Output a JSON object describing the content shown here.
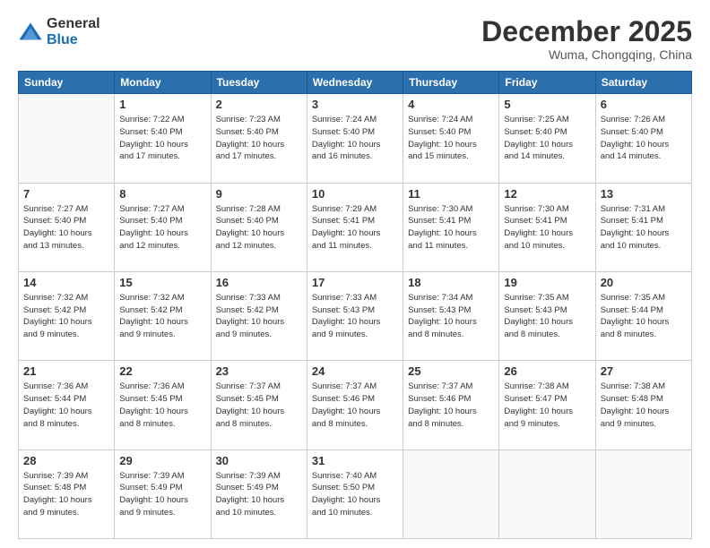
{
  "logo": {
    "general": "General",
    "blue": "Blue"
  },
  "header": {
    "month": "December 2025",
    "location": "Wuma, Chongqing, China"
  },
  "weekdays": [
    "Sunday",
    "Monday",
    "Tuesday",
    "Wednesday",
    "Thursday",
    "Friday",
    "Saturday"
  ],
  "weeks": [
    [
      {
        "day": "",
        "info": ""
      },
      {
        "day": "1",
        "info": "Sunrise: 7:22 AM\nSunset: 5:40 PM\nDaylight: 10 hours\nand 17 minutes."
      },
      {
        "day": "2",
        "info": "Sunrise: 7:23 AM\nSunset: 5:40 PM\nDaylight: 10 hours\nand 17 minutes."
      },
      {
        "day": "3",
        "info": "Sunrise: 7:24 AM\nSunset: 5:40 PM\nDaylight: 10 hours\nand 16 minutes."
      },
      {
        "day": "4",
        "info": "Sunrise: 7:24 AM\nSunset: 5:40 PM\nDaylight: 10 hours\nand 15 minutes."
      },
      {
        "day": "5",
        "info": "Sunrise: 7:25 AM\nSunset: 5:40 PM\nDaylight: 10 hours\nand 14 minutes."
      },
      {
        "day": "6",
        "info": "Sunrise: 7:26 AM\nSunset: 5:40 PM\nDaylight: 10 hours\nand 14 minutes."
      }
    ],
    [
      {
        "day": "7",
        "info": "Sunrise: 7:27 AM\nSunset: 5:40 PM\nDaylight: 10 hours\nand 13 minutes."
      },
      {
        "day": "8",
        "info": "Sunrise: 7:27 AM\nSunset: 5:40 PM\nDaylight: 10 hours\nand 12 minutes."
      },
      {
        "day": "9",
        "info": "Sunrise: 7:28 AM\nSunset: 5:40 PM\nDaylight: 10 hours\nand 12 minutes."
      },
      {
        "day": "10",
        "info": "Sunrise: 7:29 AM\nSunset: 5:41 PM\nDaylight: 10 hours\nand 11 minutes."
      },
      {
        "day": "11",
        "info": "Sunrise: 7:30 AM\nSunset: 5:41 PM\nDaylight: 10 hours\nand 11 minutes."
      },
      {
        "day": "12",
        "info": "Sunrise: 7:30 AM\nSunset: 5:41 PM\nDaylight: 10 hours\nand 10 minutes."
      },
      {
        "day": "13",
        "info": "Sunrise: 7:31 AM\nSunset: 5:41 PM\nDaylight: 10 hours\nand 10 minutes."
      }
    ],
    [
      {
        "day": "14",
        "info": "Sunrise: 7:32 AM\nSunset: 5:42 PM\nDaylight: 10 hours\nand 9 minutes."
      },
      {
        "day": "15",
        "info": "Sunrise: 7:32 AM\nSunset: 5:42 PM\nDaylight: 10 hours\nand 9 minutes."
      },
      {
        "day": "16",
        "info": "Sunrise: 7:33 AM\nSunset: 5:42 PM\nDaylight: 10 hours\nand 9 minutes."
      },
      {
        "day": "17",
        "info": "Sunrise: 7:33 AM\nSunset: 5:43 PM\nDaylight: 10 hours\nand 9 minutes."
      },
      {
        "day": "18",
        "info": "Sunrise: 7:34 AM\nSunset: 5:43 PM\nDaylight: 10 hours\nand 8 minutes."
      },
      {
        "day": "19",
        "info": "Sunrise: 7:35 AM\nSunset: 5:43 PM\nDaylight: 10 hours\nand 8 minutes."
      },
      {
        "day": "20",
        "info": "Sunrise: 7:35 AM\nSunset: 5:44 PM\nDaylight: 10 hours\nand 8 minutes."
      }
    ],
    [
      {
        "day": "21",
        "info": "Sunrise: 7:36 AM\nSunset: 5:44 PM\nDaylight: 10 hours\nand 8 minutes."
      },
      {
        "day": "22",
        "info": "Sunrise: 7:36 AM\nSunset: 5:45 PM\nDaylight: 10 hours\nand 8 minutes."
      },
      {
        "day": "23",
        "info": "Sunrise: 7:37 AM\nSunset: 5:45 PM\nDaylight: 10 hours\nand 8 minutes."
      },
      {
        "day": "24",
        "info": "Sunrise: 7:37 AM\nSunset: 5:46 PM\nDaylight: 10 hours\nand 8 minutes."
      },
      {
        "day": "25",
        "info": "Sunrise: 7:37 AM\nSunset: 5:46 PM\nDaylight: 10 hours\nand 8 minutes."
      },
      {
        "day": "26",
        "info": "Sunrise: 7:38 AM\nSunset: 5:47 PM\nDaylight: 10 hours\nand 9 minutes."
      },
      {
        "day": "27",
        "info": "Sunrise: 7:38 AM\nSunset: 5:48 PM\nDaylight: 10 hours\nand 9 minutes."
      }
    ],
    [
      {
        "day": "28",
        "info": "Sunrise: 7:39 AM\nSunset: 5:48 PM\nDaylight: 10 hours\nand 9 minutes."
      },
      {
        "day": "29",
        "info": "Sunrise: 7:39 AM\nSunset: 5:49 PM\nDaylight: 10 hours\nand 9 minutes."
      },
      {
        "day": "30",
        "info": "Sunrise: 7:39 AM\nSunset: 5:49 PM\nDaylight: 10 hours\nand 10 minutes."
      },
      {
        "day": "31",
        "info": "Sunrise: 7:40 AM\nSunset: 5:50 PM\nDaylight: 10 hours\nand 10 minutes."
      },
      {
        "day": "",
        "info": ""
      },
      {
        "day": "",
        "info": ""
      },
      {
        "day": "",
        "info": ""
      }
    ]
  ]
}
